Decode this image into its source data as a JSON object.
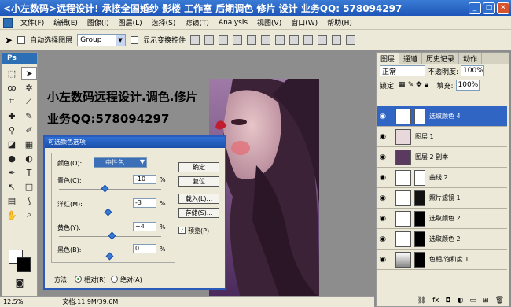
{
  "window": {
    "title": "<小左数码>远程设计! 承接全国婚纱 影楼 工作室 后期调色 修片 设计 业务QQ: 578094297"
  },
  "menu": [
    "文件(F)",
    "编辑(E)",
    "图像(I)",
    "图层(L)",
    "选择(S)",
    "滤镜(T)",
    "Analysis",
    "视图(V)",
    "窗口(W)",
    "帮助(H)"
  ],
  "options": {
    "auto_select_label": "自动选择图层",
    "group_value": "Group",
    "show_transform_label": "显示变换控件"
  },
  "toolbox": {
    "header": "Ps"
  },
  "canvas": {
    "line1": "小左数码远程设计.调色.修片",
    "line2": "业务QQ:578094297"
  },
  "status": {
    "zoom": "12.5%",
    "doc": "文档:11.9M/39.6M"
  },
  "dialog": {
    "title": "可选颜色选项",
    "color_label": "颜色(O):",
    "color_value": "中性色",
    "rows": [
      {
        "label": "青色(C):",
        "value": "-10",
        "unit": "%",
        "level": -10
      },
      {
        "label": "洋红(M):",
        "value": "-3",
        "unit": "%",
        "level": -3
      },
      {
        "label": "黄色(Y):",
        "value": "+4",
        "unit": "%",
        "level": 4
      },
      {
        "label": "黑色(B):",
        "value": "0",
        "unit": "%",
        "level": 0
      }
    ],
    "buttons": [
      "确定",
      "复位",
      "载入(L)...",
      "存储(S)..."
    ],
    "preview_label": "预览(P)",
    "method_label": "方法:",
    "method_relative": "相对(R)",
    "method_absolute": "绝对(A)"
  },
  "layers": {
    "tabs": [
      "图层",
      "通道",
      "历史记录",
      "动作"
    ],
    "blend_mode": "正常",
    "opacity_label": "不透明度:",
    "opacity": "100%",
    "lock_label": "锁定:",
    "fill_label": "填充:",
    "fill": "100%",
    "items": [
      {
        "name": "选取颜色 4",
        "selected": true
      },
      {
        "name": "图层 1",
        "selected": false
      },
      {
        "name": "图层 2 副本",
        "selected": false
      },
      {
        "name": "曲线 2",
        "selected": false
      },
      {
        "name": "照片滤镜 1",
        "selected": false
      },
      {
        "name": "选取颜色 2 ...",
        "selected": false
      },
      {
        "name": "选取颜色 2",
        "selected": false
      },
      {
        "name": "色相/饱和度 1",
        "selected": false
      }
    ]
  }
}
